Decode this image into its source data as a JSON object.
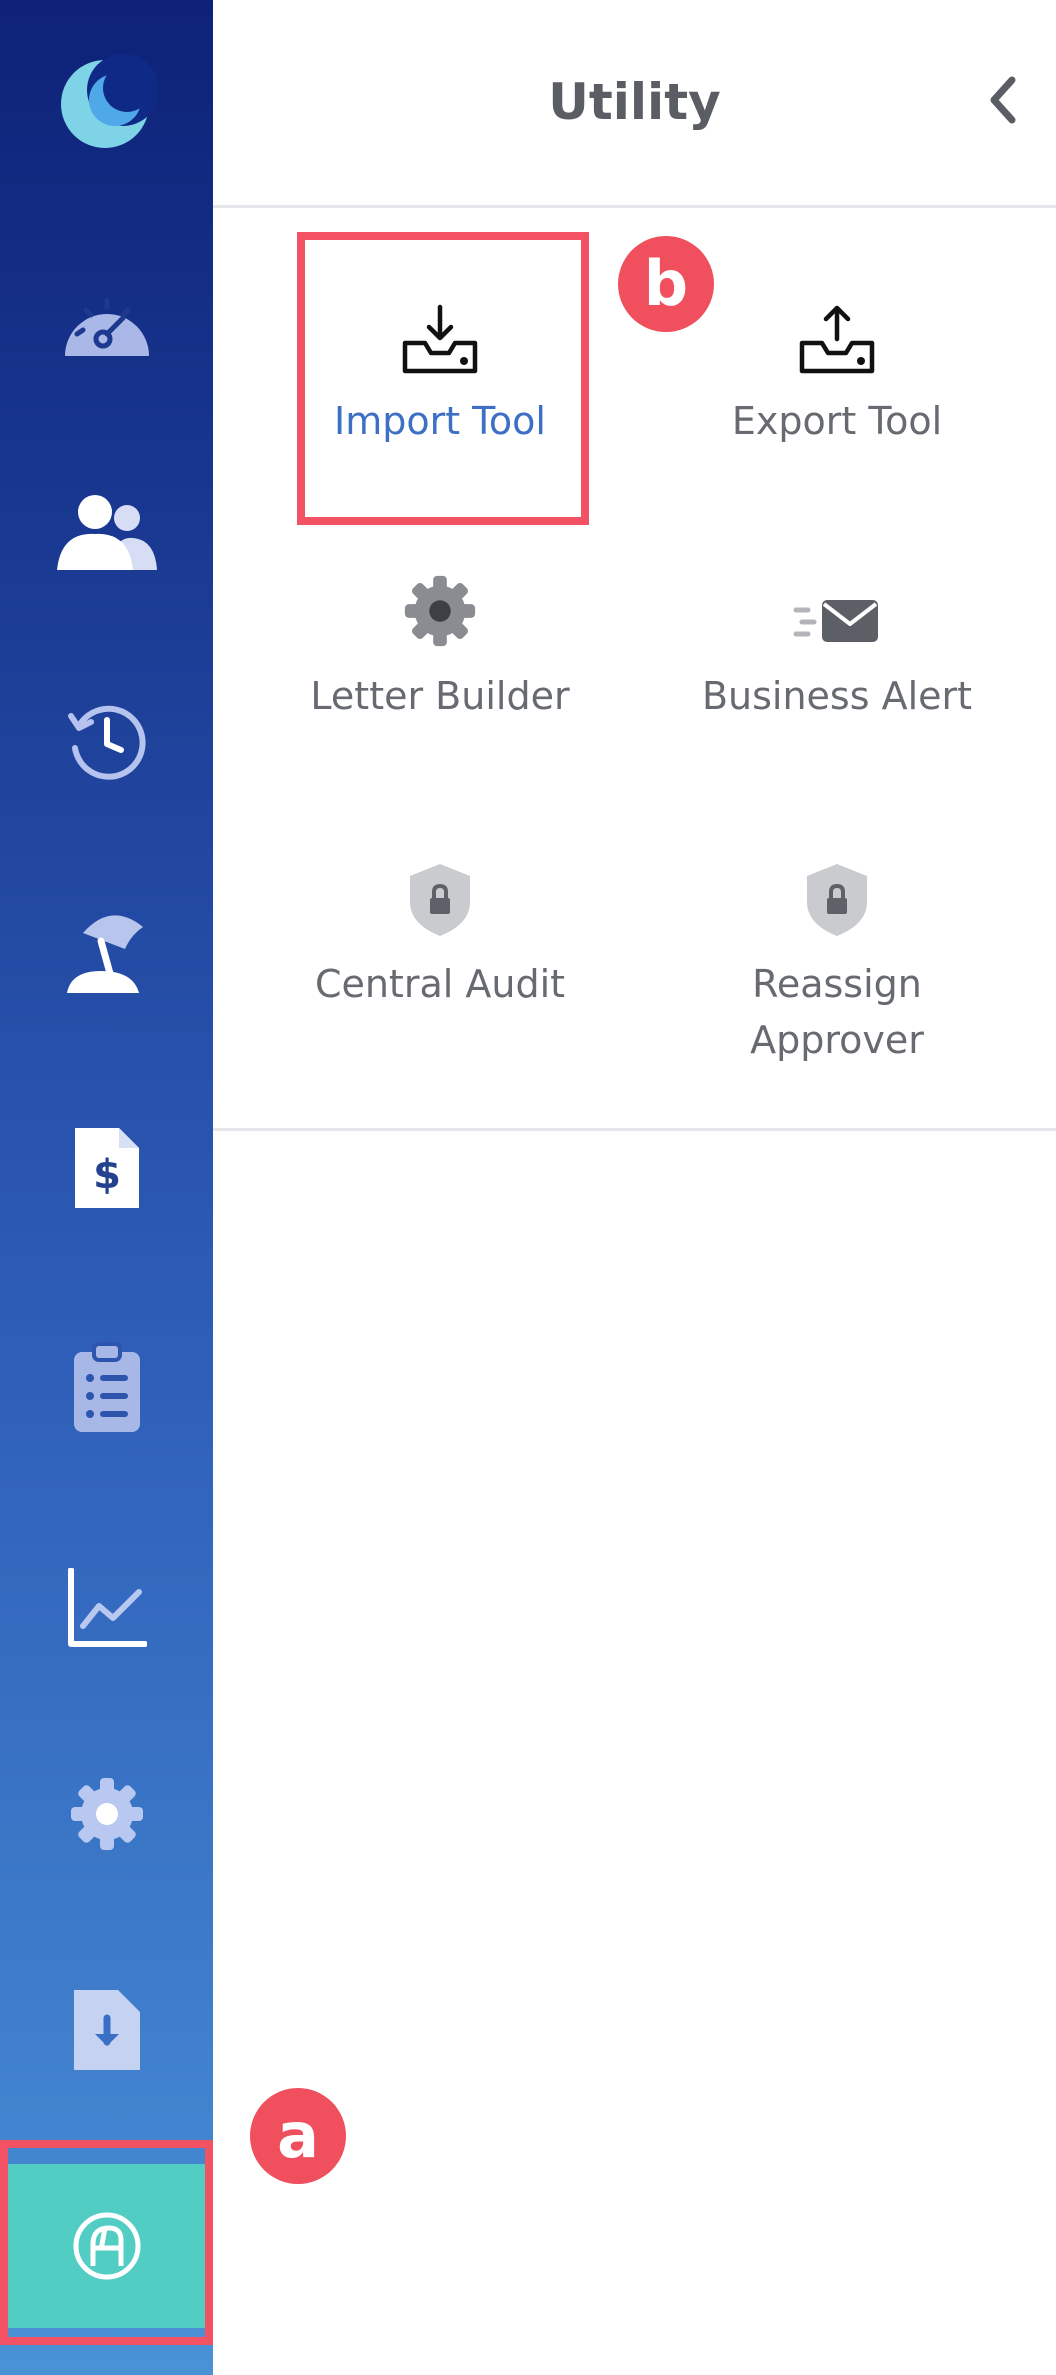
{
  "panel": {
    "title": "Utility"
  },
  "tools": [
    {
      "label": "Import Tool",
      "icon": "import-icon",
      "active": true
    },
    {
      "label": "Export Tool",
      "icon": "export-icon",
      "active": false
    },
    {
      "label": "Letter Builder",
      "icon": "gear-icon",
      "active": false
    },
    {
      "label": "Business Alert",
      "icon": "mail-icon",
      "active": false
    },
    {
      "label": "Central Audit",
      "icon": "shield-lock-icon",
      "active": false
    },
    {
      "label": "Reassign Approver",
      "icon": "shield-lock-icon",
      "active": false
    }
  ],
  "sidebar": {
    "items": [
      {
        "icon": "moon-logo-icon"
      },
      {
        "icon": "speedometer-icon"
      },
      {
        "icon": "users-icon"
      },
      {
        "icon": "history-clock-icon"
      },
      {
        "icon": "beach-umbrella-icon"
      },
      {
        "icon": "invoice-dollar-icon"
      },
      {
        "icon": "clipboard-list-icon"
      },
      {
        "icon": "line-chart-icon"
      },
      {
        "icon": "gear-icon"
      },
      {
        "icon": "document-download-icon"
      },
      {
        "icon": "utility-icon",
        "active": true
      }
    ]
  },
  "annotations": {
    "a": "a",
    "b": "b"
  },
  "colors": {
    "sidebar_top": "#0d2278",
    "sidebar_bottom": "#4a92d6",
    "active_item": "#52cdc4",
    "active_label": "#3d6fc4",
    "annotation": "#f04f5e"
  }
}
